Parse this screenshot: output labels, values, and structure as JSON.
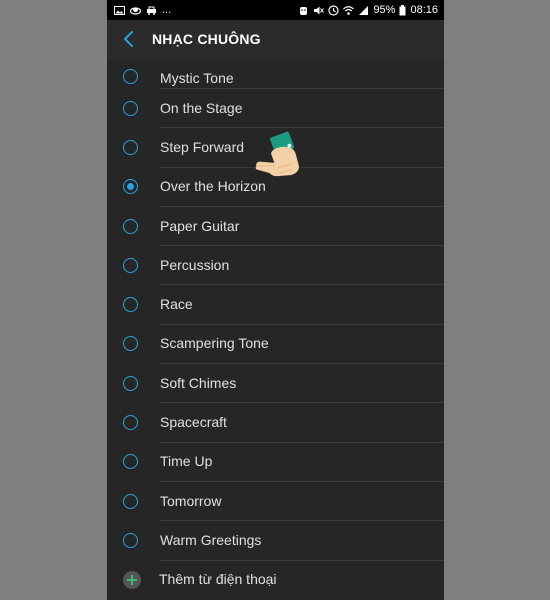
{
  "status_bar": {
    "left_icons": [
      "image-icon",
      "cloud-icon",
      "car-icon"
    ],
    "overflow": "...",
    "right_icons": [
      "alarm-icon",
      "mute-icon",
      "clock-icon",
      "wifi-icon",
      "signal-icon",
      "battery-icon"
    ],
    "battery": "95%",
    "time": "08:16"
  },
  "header": {
    "title": "NHẠC CHUÔNG",
    "back_icon": "back-arrow-icon"
  },
  "ringtones": [
    {
      "label": "Mystic Tone",
      "selected": false
    },
    {
      "label": "On the Stage",
      "selected": false
    },
    {
      "label": "Step Forward",
      "selected": false
    },
    {
      "label": "Over the Horizon",
      "selected": true
    },
    {
      "label": "Paper Guitar",
      "selected": false
    },
    {
      "label": "Percussion",
      "selected": false
    },
    {
      "label": "Race",
      "selected": false
    },
    {
      "label": "Scampering Tone",
      "selected": false
    },
    {
      "label": "Soft Chimes",
      "selected": false
    },
    {
      "label": "Spacecraft",
      "selected": false
    },
    {
      "label": "Time Up",
      "selected": false
    },
    {
      "label": "Tomorrow",
      "selected": false
    },
    {
      "label": "Warm Greetings",
      "selected": false
    }
  ],
  "add_from_phone": {
    "label": "Thêm từ điện thoại",
    "icon": "plus-icon"
  },
  "colors": {
    "accent": "#2aa3de",
    "add_icon": "#3cb878",
    "background": "#262626"
  }
}
